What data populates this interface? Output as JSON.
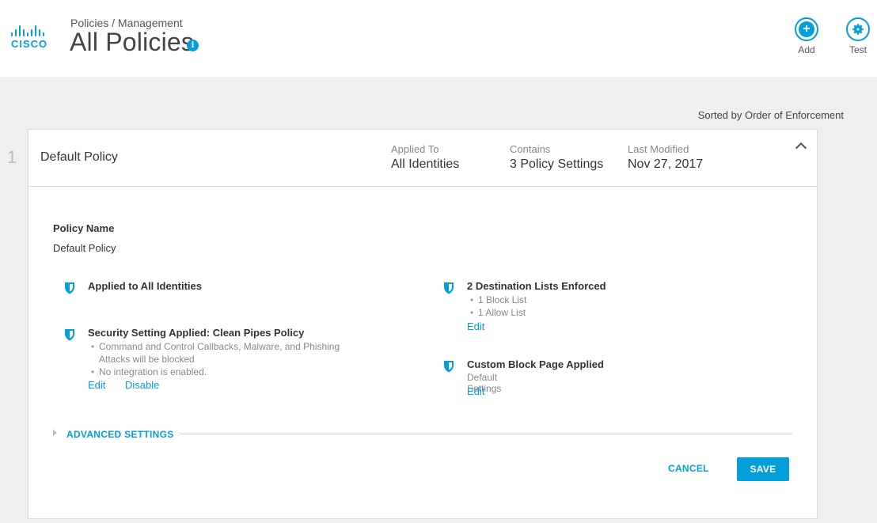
{
  "brand": {
    "logo_text": "CISCO",
    "accent": "#049fd9"
  },
  "header": {
    "breadcrumb": "Policies / Management",
    "title": "All Policies",
    "info_icon": "i",
    "add_label": "Add",
    "test_label": "Test"
  },
  "sort_text": "Sorted by Order of Enforcement",
  "policy": {
    "index": "1",
    "name": "Default Policy",
    "applied_to_label": "Applied To",
    "applied_to_value": "All Identities",
    "contains_label": "Contains",
    "contains_value": "3 Policy Settings",
    "modified_label": "Last Modified",
    "modified_value": "Nov 27, 2017"
  },
  "details": {
    "policy_name_label": "Policy Name",
    "policy_name_value": "Default Policy",
    "applied_identities": "Applied to All Identities",
    "security_title": "Security Setting Applied: Clean Pipes Policy",
    "security_bullets": [
      "Command and Control Callbacks, Malware, and Phishing Attacks will be blocked",
      "No integration is enabled."
    ],
    "security_edit": "Edit",
    "security_disable": "Disable",
    "destination_title": "2 Destination Lists Enforced",
    "destination_bullets": [
      "1 Block List",
      "1 Allow List"
    ],
    "destination_edit": "Edit",
    "block_page_title": "Custom Block Page Applied",
    "block_page_sub": "Default Settings",
    "block_page_edit": "Edit"
  },
  "advanced_label": "ADVANCED SETTINGS",
  "actions": {
    "cancel": "CANCEL",
    "save": "SAVE"
  }
}
